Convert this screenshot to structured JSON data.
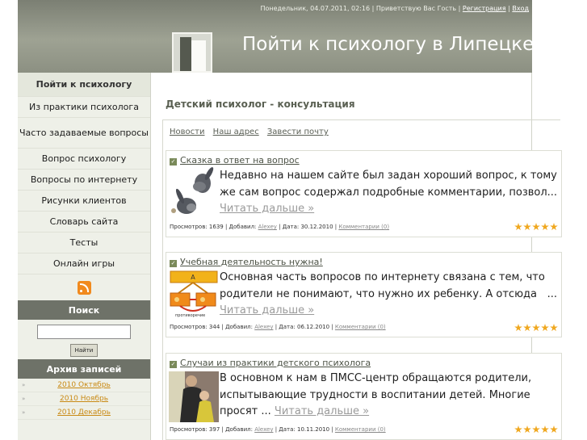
{
  "header": {
    "topbar_text": "Понедельник, 04.07.2011, 02:16 | Приветствую Вас Гость | ",
    "register_link": "Регистрация",
    "separator": " | ",
    "login_link": "Вход",
    "site_title": "Пойти к психологу в Липецке"
  },
  "sidebar": {
    "menu": [
      {
        "label": "Пойти к психологу"
      },
      {
        "label": "Из практики психолога"
      },
      {
        "label": "Часто задаваемые вопросы"
      },
      {
        "label": "Вопрос психологу"
      },
      {
        "label": "Вопросы по интернету"
      },
      {
        "label": "Рисунки клиентов"
      },
      {
        "label": "Словарь сайта"
      },
      {
        "label": "Тесты"
      },
      {
        "label": "Онлайн игры"
      }
    ],
    "search_heading": "Поиск",
    "search_button": "Найти",
    "archive_heading": "Архив записей",
    "archive": [
      "2010 Октябрь",
      "2010 Ноябрь",
      "2010 Декабрь"
    ]
  },
  "main": {
    "heading": "Детский психолог - консультация",
    "tabs": [
      "Новости",
      "Наш адрес",
      "Завести почту"
    ],
    "articles": [
      {
        "title": "Сказка в ответ на вопрос",
        "text": "Недавно на нашем сайте был задан хороший вопрос, к тому же сам вопрос содержал подробные комментарии, позвол",
        "dots": "...",
        "more": "Читать дальше »",
        "views": "Просмотров: 1639 | Добавил: ",
        "author": "Alexey",
        "date": " | Дата: 30.12.2010 | ",
        "comments": "Комментарии (0)",
        "rating": 5
      },
      {
        "title": "Учебная деятельность нужна!",
        "text": "Основная часть вопросов по интернету связана с тем, что родители не понимают, что нужно их ребенку. А отсюда",
        "dots": "...",
        "more": "Читать дальше »",
        "views": "Просмотров: 344 | Добавил: ",
        "author": "Alexey",
        "date": " | Дата: 06.12.2010 | ",
        "comments": "Комментарии (0)",
        "rating": 5
      },
      {
        "title": "Случаи из практики детского психолога",
        "text": "В основном к нам в ПМСС-центр обращаются родители, испытывающие трудности в воспитании детей. Многие просят ...",
        "dots": "",
        "more": "Читать дальше »",
        "views": "Просмотров: 397 | Добавил: ",
        "author": "Alexey",
        "date": " | Дата: 10.11.2010 | ",
        "comments": "Комментарии (0)",
        "rating": 5
      }
    ],
    "diagram_caption": "противоречие"
  },
  "colors": {
    "header_gradient": "#9ea293",
    "sidebar_bg": "#eef0e8",
    "sidebar_heading_bg": "#6e7268",
    "archive_link": "#c98a15",
    "star": "#f0a820"
  },
  "icons": [
    "rss-icon",
    "checkbox-icon",
    "star-icon"
  ]
}
